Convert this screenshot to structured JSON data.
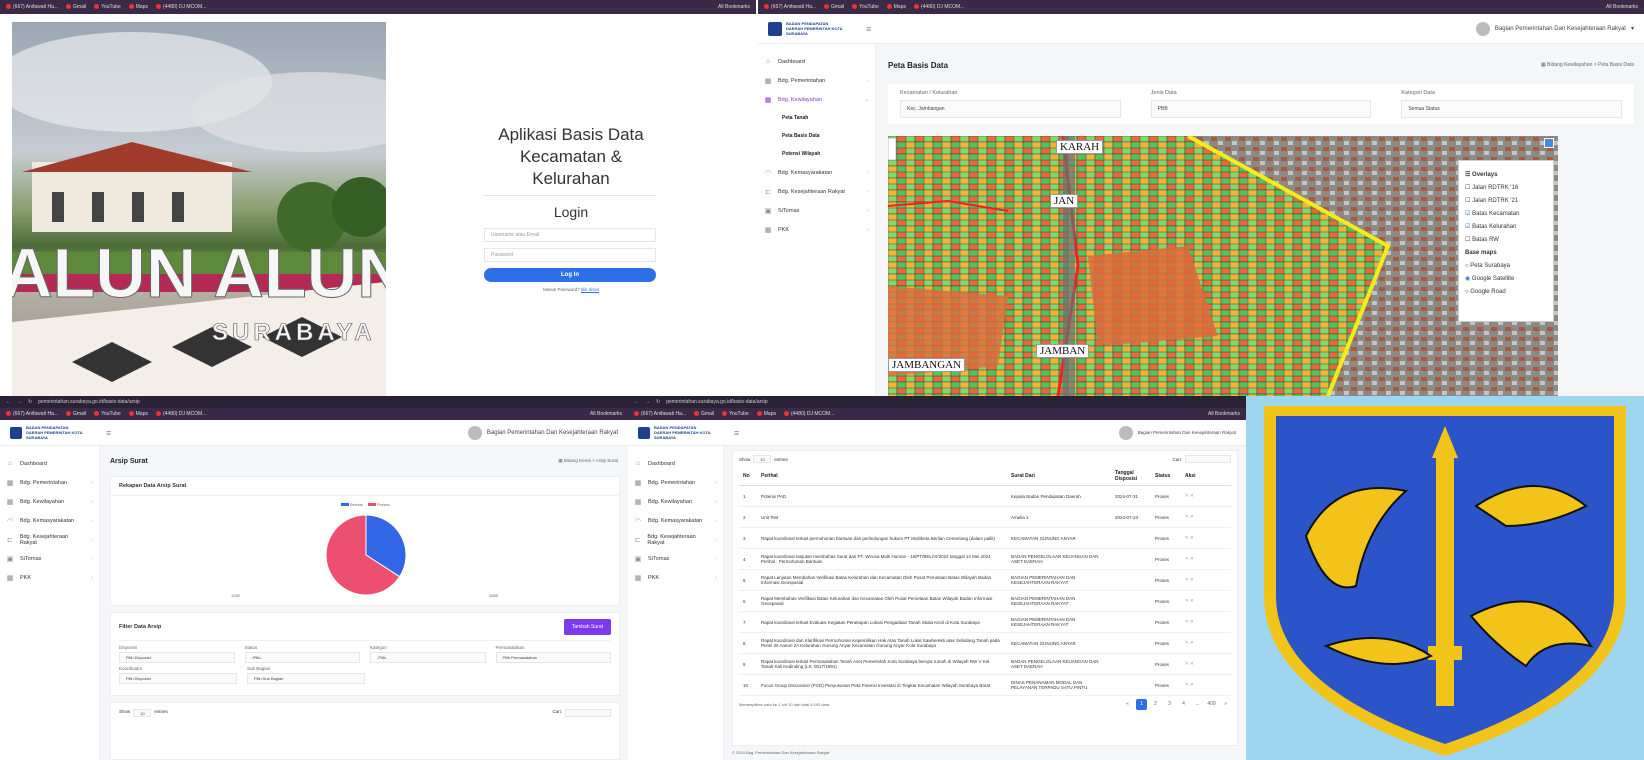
{
  "browser": {
    "tabs": [
      "(667) Anifawati Ha...",
      "Gmail",
      "YouTube",
      "Maps",
      "(4480) DJ MCOM..."
    ],
    "bookmarks": "All Bookmarks",
    "url": "pemerintahan.surabaya.go.id/basis-data/arsip"
  },
  "login": {
    "banner_text": "SURABAYA",
    "sign_text": "ALUN ALUN",
    "app_title_1": "Aplikasi Basis Data",
    "app_title_2": "Kecamatan &",
    "app_title_3": "Kelurahan",
    "heading": "Login",
    "username_placeholder": "Username atau Email",
    "password_placeholder": "Password",
    "login_button": "Log In",
    "forgot_text": "Masuk Password?",
    "forgot_link": "klik disini"
  },
  "app": {
    "logo_text": "BADAN PENDAPATAN DAERAH PEMERINTAH KOTA SURABAYA",
    "user_name": "Bagian Pemerintahan Dan Kesejahteraan Rakyat",
    "sidebar": [
      {
        "icon": "home-icon",
        "label": "Dashboard"
      },
      {
        "icon": "grid-icon",
        "label": "Bdg. Pemerintahan"
      },
      {
        "icon": "grid-icon",
        "label": "Bdg. Kewilayahan"
      },
      {
        "icon": "wifi-icon",
        "label": "Bdg. Kemasyarakatan"
      },
      {
        "icon": "car-icon",
        "label": "Bdg. Kesejahteraan Rakyat"
      },
      {
        "icon": "box-icon",
        "label": "SiTornas"
      },
      {
        "icon": "grid-icon",
        "label": "PKK"
      }
    ],
    "sub_items": [
      "Peta Tanah",
      "Peta Basis Data",
      "Potensi Wilayah"
    ]
  },
  "map_page": {
    "title": "Peta Basis Data",
    "breadcrumb": "Bidang Kewilayahan > Peta Basis Data",
    "filter_labels": [
      "Kecamatan / Kelurahan",
      "Jenis Data",
      "Kategori Data"
    ],
    "filter_values": [
      "Kec. Jambangan",
      "PBB",
      "Semua Status"
    ],
    "map_labels": [
      "KARAH",
      "JAMBANGAN",
      "JAMBAN",
      "JAN"
    ],
    "layers": {
      "overlays_title": "Overlays",
      "overlays": [
        {
          "label": "Jalan RDTRK '16",
          "checked": false
        },
        {
          "label": "Jalan RDTRK '21",
          "checked": false
        },
        {
          "label": "Batas Kecamatan",
          "checked": true
        },
        {
          "label": "Batas Kelurahan",
          "checked": true
        },
        {
          "label": "Batas RW",
          "checked": false
        }
      ],
      "base_title": "Base maps",
      "base": [
        {
          "label": "Peta Surabaya",
          "checked": false
        },
        {
          "label": "Google Satellite",
          "checked": true
        },
        {
          "label": "Google Road",
          "checked": false
        }
      ]
    }
  },
  "arsip_page": {
    "title": "Arsip Surat",
    "breadcrumb": "Bidang Kesra > Arsip Surat",
    "chart_title": "Rekapan Data Arsip Surat",
    "legend": [
      "Selesai",
      "Proses"
    ],
    "chart_labels": [
      "1390",
      "2685"
    ],
    "filter_title": "Filter Data Arsip",
    "filter_button": "Tambah Surat",
    "f1_labels": [
      "Disposisi",
      "Status",
      "Kategori",
      "Permasalahan"
    ],
    "f1_values": [
      "Pilih Disposisi",
      "-Pilih-",
      "-Pilih-",
      "Pilih Permasalahan"
    ],
    "f2_labels": [
      "Koordinator",
      "Sub Bagian"
    ],
    "f2_values": [
      "Pilih Disposisi",
      "Pilih Sub Bagian"
    ],
    "show_text": "Show",
    "entries_text": "entries",
    "show_value": "10",
    "search_label": "Cari:"
  },
  "chart_data": {
    "type": "pie",
    "categories": [
      "Selesai",
      "Proses"
    ],
    "values": [
      1390,
      2685
    ],
    "colors": [
      "#3366e6",
      "#ec4f6f"
    ],
    "legend_position": "top"
  },
  "table_page": {
    "show_text": "Show",
    "show_value": "10",
    "entries_text": "entries",
    "search_label": "Cari:",
    "headers": [
      "No",
      "Perihal",
      "Surat Dari",
      "Tanggal Disposisi",
      "Status",
      "Aksi"
    ],
    "rows": [
      [
        "1",
        "Potensi PAD",
        "Kepala Badan Pendapatan Daerah",
        "2024-07-31",
        "Proses"
      ],
      [
        "2",
        "Unit Test",
        "Amelia 1",
        "2024-07-23",
        "Proses"
      ],
      [
        "3",
        "Rapat koordinasi terkait permohonan bantuan dan perlindungan hukum PT Multiheta Berlian Cemerlang (dalam pailit)",
        "KECAMATAN GUNUNG ANYAR",
        "",
        "Proses"
      ],
      [
        "4",
        "Rapat koordinasi tanjutan membahas Surat dari PT. Wiruna Multi Human - 15/PT/BEL/VI/2024 tanggal 14 Mei 2024 Perihal : Permohonan Bantuan",
        "BADAN PENGELOLAAN KEUANGAN DAN ASET DAERAH",
        "",
        "Proses"
      ],
      [
        "5",
        "Rapat Lanjutan Membahas Verifikasi Batas Kelurahan dan Kecamatan Oleh Pusat Pemetaan Batas Wilayah Badan Informasi Geospasial",
        "BAGIAN PEMERINTAHAN DAN KESEJAHTERAAN RAKYAT",
        "",
        "Proses"
      ],
      [
        "6",
        "Rapat Membahas Verifikasi Batas Kelurahan dan Kecamatan Oleh Pusat Pemetaan Batas Wilayah Badan Informasi Geospasial",
        "BAGIAN PEMERINTAHAN DAN KESEJAHTERAAN RAKYAT",
        "",
        "Proses"
      ],
      [
        "7",
        "Rapat koordinasi terkait Evaluasi Kegiatan Penetapan Lokasi Pengadaan Tanah Skala Kecil di Kota Surabaya",
        "BAGIAN PEMERINTAHAN DAN KESEJAHTERAAN RAKYAT",
        "",
        "Proses"
      ],
      [
        "8",
        "Rapat koordinasi dan Klarifikasi Permohonan Kepemilikan Hak Atas Tanah Lokal Sawherekti atas Sebidang Tanah pada Persil 30 Aneon 2A Kelurahan Gunung Anyar Kecamatan Gunung Anyar Kota Surabaya",
        "KECAMATAN GUNUNG ANYAR",
        "",
        "Proses"
      ],
      [
        "9",
        "Rapat koordinasi terkait Permasalahan Tanah Aset Pemerintah Kota Surabaya berupa rumah di Wilayah RW V Kel. Tanah Kali Kedinding (LS. 0017/1991)",
        "BADAN PENGELOLAAN KEUANGAN DAN ASET DAERAH",
        "",
        "Proses"
      ],
      [
        "10",
        "Focus Group Discussion (FGD) Penyusunan Peta Potensi Investasi di Tingkat Kecamatan Wilayah Surabaya Barat",
        "DINAS PENANAMAN MODAL DAN PELAYANAN TERPADU SATU PINTU",
        "",
        "Proses"
      ]
    ],
    "footer_text": "Menampilkan data ke-1 s/d 10 dari total 4,093 data",
    "pages": [
      "«",
      "1",
      "2",
      "3",
      "4",
      "...",
      "409",
      "»"
    ],
    "copyright": "© 2024 Bag. Pemerintahan Dan Kesejahteraan Rakyat"
  },
  "colors": {
    "primary": "#7c3aed",
    "blue": "#2d6fe8",
    "crest_bg": "#2b54c8",
    "crest_gold": "#f2c318"
  }
}
